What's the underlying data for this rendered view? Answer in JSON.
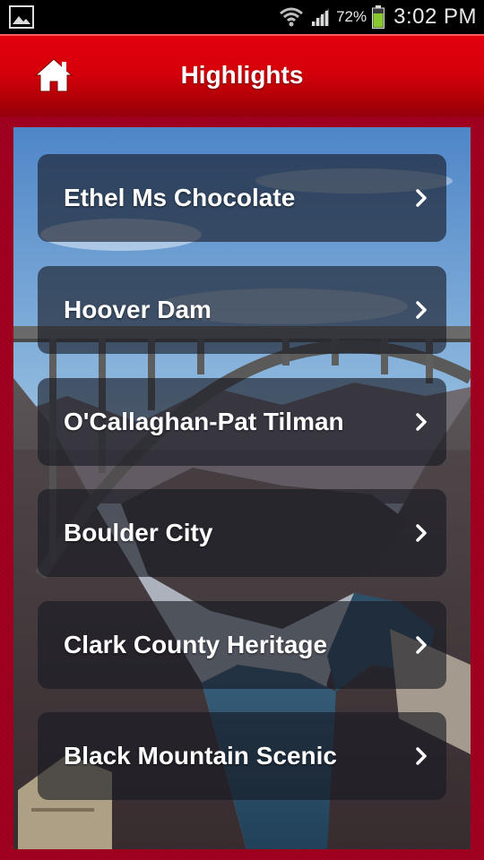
{
  "status_bar": {
    "battery_percent": "72%",
    "time": "3:02 PM",
    "icons": [
      "gallery-icon",
      "wifi-icon",
      "signal-icon",
      "battery-icon"
    ]
  },
  "header": {
    "title": "Highlights",
    "home_icon": "home-icon",
    "color": "#d60009"
  },
  "list": {
    "items": [
      {
        "label": "Ethel Ms Chocolate"
      },
      {
        "label": "Hoover Dam"
      },
      {
        "label": "O'Callaghan-Pat Tilman"
      },
      {
        "label": "Boulder City"
      },
      {
        "label": "Clark County Heritage"
      },
      {
        "label": "Black Mountain Scenic"
      }
    ],
    "chevron_icon": "chevron-right-icon"
  }
}
